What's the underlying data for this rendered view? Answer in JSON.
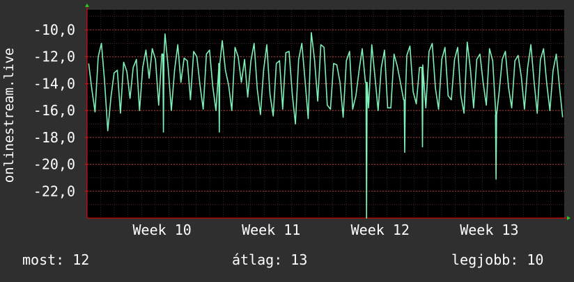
{
  "chart_data": {
    "type": "line",
    "ylabel": "onlinestream.live",
    "ylim": [
      -24.0,
      -8.5
    ],
    "yticks": [
      -10.0,
      -12.0,
      -14.0,
      -16.0,
      -18.0,
      -20.0,
      -22.0
    ],
    "ytick_labels": [
      "-10,0",
      "-12,0",
      "-14,0",
      "-16,0",
      "-18,0",
      "-20,0",
      "-22,0"
    ],
    "xlim": [
      0,
      35
    ],
    "xticks": [
      {
        "label": "Week 10",
        "x": 5.5
      },
      {
        "label": "Week 11",
        "x": 13.5
      },
      {
        "label": "Week 12",
        "x": 21.5
      },
      {
        "label": "Week 13",
        "x": 29.5
      }
    ],
    "grid": true,
    "background_color": "#000000",
    "line_color": "#7ff0b8",
    "grid_color": "#6a3a3a",
    "axis_color": "#ff0000",
    "arrow_color": "#22cc22",
    "spikes": [
      {
        "day": 5.6,
        "value": -17.6
      },
      {
        "day": 9.7,
        "value": -17.6
      },
      {
        "day": 20.5,
        "value": -24.0
      },
      {
        "day": 23.3,
        "value": -19.1
      },
      {
        "day": 24.6,
        "value": -18.7
      },
      {
        "day": 30.0,
        "value": -21.1
      }
    ],
    "series": [
      {
        "values": [
          -12.5,
          -14.4,
          -16.1,
          -12.0,
          -11.0,
          -13.8,
          -17.5,
          -15.0,
          -13.2,
          -13.0,
          -16.2,
          -12.4,
          -13.1,
          -15.1,
          -12.8,
          -12.2,
          -16.0,
          -12.8,
          -11.5,
          -13.6,
          -11.4,
          -12.2,
          -15.6,
          -11.8,
          -10.3,
          -12.8,
          -16.0,
          -13.0,
          -11.1,
          -13.9,
          -12.1,
          -12.3,
          -15.2,
          -11.6,
          -12.0,
          -14.1,
          -15.9,
          -11.8,
          -11.5,
          -14.2,
          -16.0,
          -12.5,
          -10.8,
          -13.0,
          -14.1,
          -16.0,
          -11.3,
          -12.0,
          -13.9,
          -12.2,
          -15.0,
          -12.3,
          -11.0,
          -14.4,
          -16.3,
          -13.0,
          -11.1,
          -14.8,
          -16.4,
          -12.5,
          -12.3,
          -15.9,
          -11.7,
          -11.6,
          -14.8,
          -17.0,
          -12.2,
          -11.0,
          -13.7,
          -16.6,
          -10.2,
          -12.2,
          -15.3,
          -11.1,
          -11.3,
          -15.6,
          -15.9,
          -12.5,
          -12.6,
          -13.9,
          -16.5,
          -12.3,
          -11.6,
          -15.9,
          -14.9,
          -13.0,
          -11.4,
          -13.9,
          -15.8,
          -11.1,
          -13.5,
          -16.0,
          -12.8,
          -11.5,
          -15.8,
          -15.8,
          -11.8,
          -12.7,
          -13.9,
          -15.2,
          -11.9,
          -11.2,
          -14.6,
          -15.5,
          -12.8,
          -12.6,
          -15.8,
          -11.6,
          -11.0,
          -14.3,
          -15.9,
          -12.2,
          -11.3,
          -14.9,
          -15.2,
          -12.2,
          -11.3,
          -14.9,
          -16.2,
          -10.9,
          -12.9,
          -15.8,
          -12.2,
          -11.8,
          -13.9,
          -15.6,
          -11.4,
          -12.3,
          -16.3,
          -14.7,
          -12.2,
          -11.6,
          -14.3,
          -15.8,
          -12.3,
          -11.9,
          -13.5,
          -15.9,
          -12.8,
          -11.1,
          -13.8,
          -16.2,
          -12.2,
          -11.4,
          -14.0,
          -16.0,
          -13.0,
          -11.8,
          -14.2,
          -16.5
        ]
      }
    ]
  },
  "stats": {
    "current": "most: 12",
    "average": "átlag: 13",
    "best": "legjobb: 10"
  }
}
